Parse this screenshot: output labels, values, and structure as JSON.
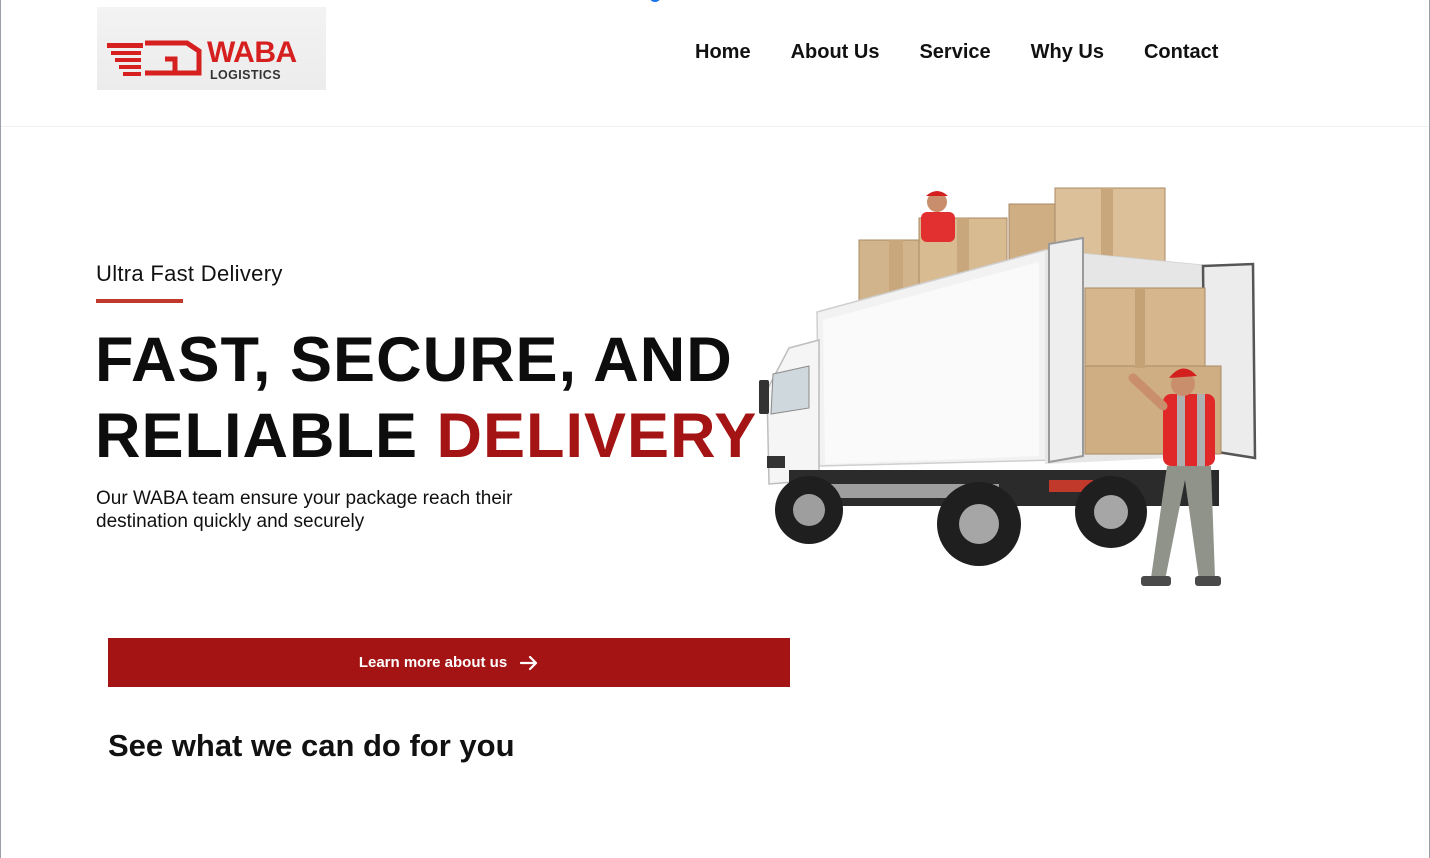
{
  "header": {
    "logo": {
      "word": "WABA",
      "sub": "LOGISTICS",
      "brand_color": "#d62020"
    },
    "nav": [
      {
        "label": "Home"
      },
      {
        "label": "About Us"
      },
      {
        "label": "Service"
      },
      {
        "label": "Why Us"
      },
      {
        "label": "Contact"
      }
    ]
  },
  "hero": {
    "eyebrow": "Ultra Fast Delivery",
    "headline_line1": "FAST, SECURE, AND",
    "headline_line2_plain": "RELIABLE",
    "headline_line2_accent": "DELIVERY",
    "description": "Our WABA team ensure your package reach their destination quickly and securely",
    "cta_label": "Learn more about us",
    "accent_color": "#a51414",
    "image_icon": "delivery-truck-illustration"
  },
  "services": {
    "title": "See what we can do for you"
  }
}
